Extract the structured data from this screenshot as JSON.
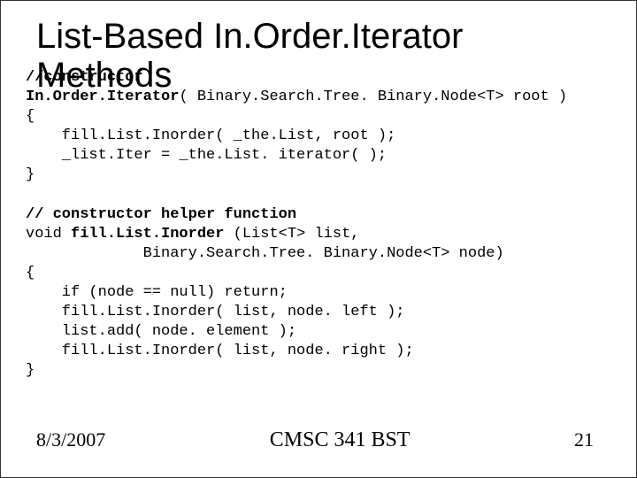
{
  "title": "List-Based In.Order.Iterator\nMethods",
  "code": {
    "l1": "//constructor",
    "l2a": "In.Order.Iterator",
    "l2b": "( Binary.Search.Tree. Binary.Node<T> root )",
    "l3": "{",
    "l4": "    fill.List.Inorder( _the.List, root );",
    "l5": "    _list.Iter = _the.List. iterator( );",
    "l6": "}",
    "blank1": "",
    "l7": "// constructor helper function",
    "l8a": "void ",
    "l8b": "fill.List.Inorder",
    "l8c": " (List<T> list,",
    "l9": "             Binary.Search.Tree. Binary.Node<T> node)",
    "l10": "{",
    "l11": "    if (node == null) return;",
    "l12": "    fill.List.Inorder( list, node. left );",
    "l13": "    list.add( node. element );",
    "l14": "    fill.List.Inorder( list, node. right );",
    "l15": "}"
  },
  "footer": {
    "date": "8/3/2007",
    "course": "CMSC 341 BST",
    "page": "21"
  }
}
